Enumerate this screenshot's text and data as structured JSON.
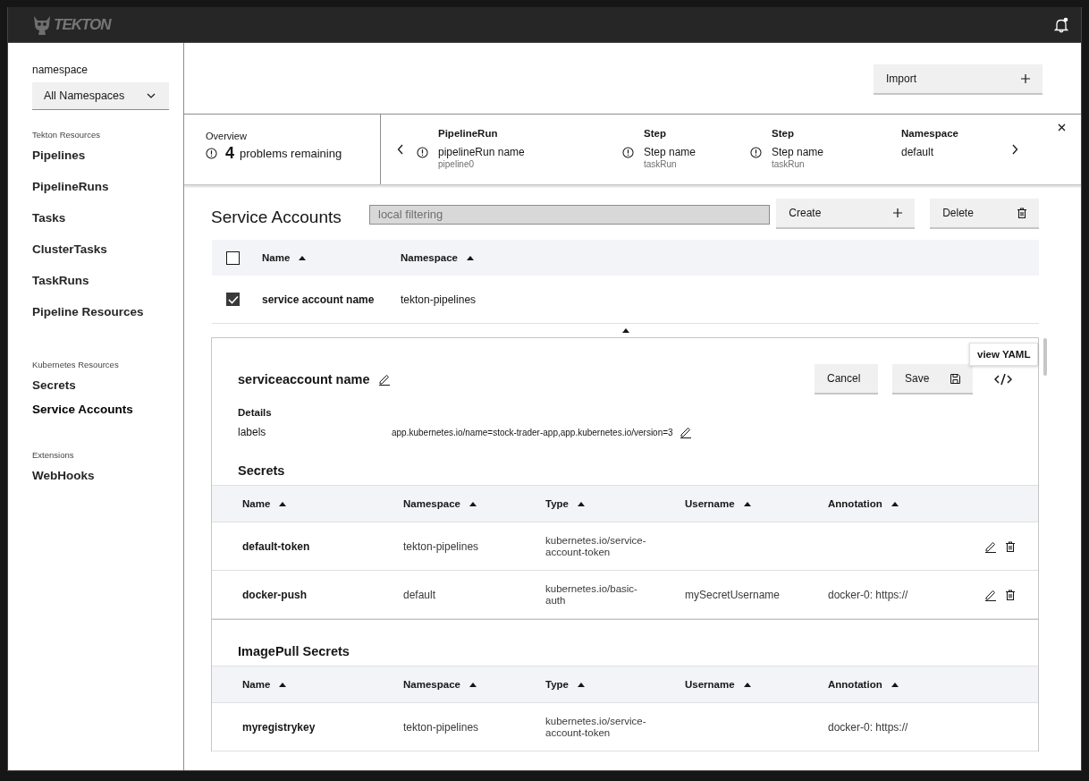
{
  "header": {
    "logo": "TEKTON",
    "notification_dot": true
  },
  "sidebar": {
    "namespace_label": "namespace",
    "namespace_select": "All Namespaces",
    "groups": [
      {
        "heading": "Tekton Resources",
        "items": [
          {
            "label": "Pipelines",
            "selected": false
          },
          {
            "label": "PipelineRuns",
            "selected": false
          },
          {
            "label": "Tasks",
            "selected": false
          },
          {
            "label": "ClusterTasks",
            "selected": false
          },
          {
            "label": "TaskRuns",
            "selected": false
          },
          {
            "label": "Pipeline Resources",
            "selected": false
          }
        ]
      },
      {
        "heading": "Kubernetes Resources",
        "items": [
          {
            "label": "Secrets",
            "selected": false
          },
          {
            "label": "Service Accounts",
            "selected": true
          }
        ]
      },
      {
        "heading": "Extensions",
        "items": [
          {
            "label": "WebHooks",
            "selected": false
          }
        ]
      }
    ]
  },
  "import_button": "Import",
  "notification": {
    "overview_label": "Overview",
    "count": "4",
    "problems": "problems remaining",
    "columns": [
      {
        "heading": "PipelineRun",
        "kind": "warning",
        "value": "pipelineRun name",
        "sub": "pipeline0"
      },
      {
        "heading": "Step",
        "kind": "warning",
        "value": "Step name",
        "sub": "taskRun"
      },
      {
        "heading": "Step",
        "kind": "warning",
        "value": "Step name",
        "sub": "taskRun"
      },
      {
        "heading": "Namespace",
        "kind": "plain",
        "value": "default"
      }
    ]
  },
  "service_accounts": {
    "title": "Service Accounts",
    "filter": {
      "placeholder": "local filtering"
    },
    "create_button": "Create",
    "delete_button": "Delete",
    "columns": [
      "Name",
      "Namespace"
    ],
    "all_checked": false,
    "rows": [
      {
        "name": "service account name",
        "namespace": "tekton-pipelines",
        "checked": true,
        "expanded": true
      }
    ]
  },
  "detail": {
    "title": "serviceaccount name",
    "cancel_button": "Cancel",
    "save_button": "Save",
    "tooltip": "view YAML",
    "details_heading": "Details",
    "labels_key": "labels",
    "labels_value": "app.kubernetes.io/name=stock-trader-app,app.kubernetes.io/version=3",
    "sections": [
      {
        "title": "Secrets",
        "columns": [
          "Name",
          "Namespace",
          "Type",
          "Username",
          "Annotation"
        ],
        "rows": [
          {
            "name": "default-token",
            "namespace": "tekton-pipelines",
            "type": "kubernetes.io/service-account-token",
            "username": "",
            "annotation": "",
            "actions": true
          },
          {
            "name": "docker-push",
            "namespace": "default",
            "type": "kubernetes.io/basic-auth",
            "username": "mySecretUsername",
            "annotation": "docker-0: https://",
            "actions": true
          }
        ]
      },
      {
        "title": "ImagePull Secrets",
        "columns": [
          "Name",
          "Namespace",
          "Type",
          "Username",
          "Annotation"
        ],
        "rows": [
          {
            "name": "myregistrykey",
            "namespace": "tekton-pipelines",
            "type": "kubernetes.io/service-account-token",
            "username": "",
            "annotation": "docker-0: https://",
            "actions": false
          }
        ]
      }
    ]
  }
}
